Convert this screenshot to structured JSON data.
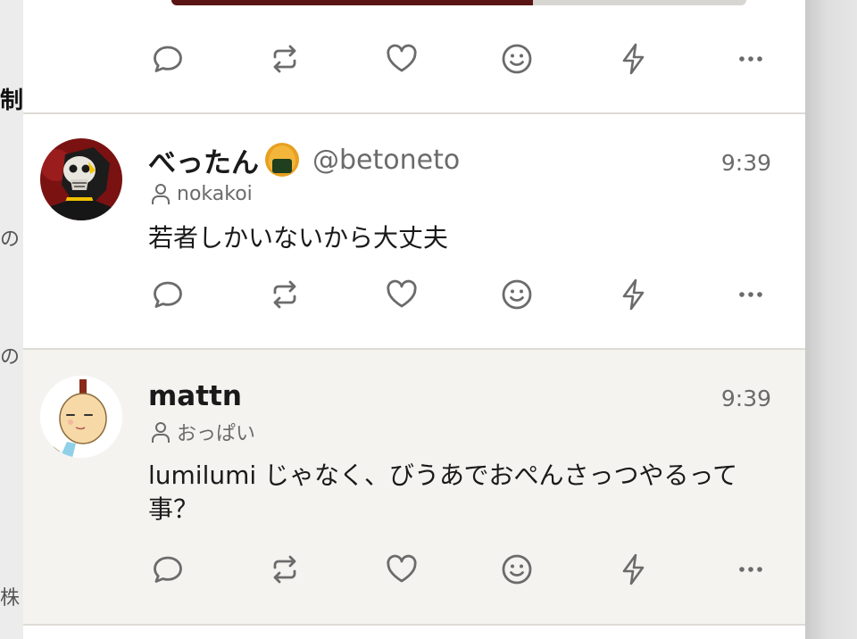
{
  "background_fragments": [
    "制",
    "の",
    "の",
    "株"
  ],
  "colors": {
    "feed_bg": "#ffffff",
    "highlight_bg": "#f4f3f0",
    "icon": "#6b6b6b",
    "text": "#1a1a1a",
    "muted": "#6b6b6b"
  },
  "posts": [
    {
      "display_name": "べったん",
      "name_emoji": "onigiri-emoji",
      "handle": "@betoneto",
      "time": "9:39",
      "sub_text": "nokakoi",
      "body": "若者しかいないから大丈夫"
    },
    {
      "display_name": "mattn",
      "handle": "",
      "time": "9:39",
      "sub_text": "おっぱい",
      "body": "lumilumi じゃなく、びうあでおぺんさっつやるって事？"
    }
  ],
  "actions": [
    "reply-icon",
    "renote-icon",
    "heart-icon",
    "smile-icon",
    "bolt-icon",
    "more-icon"
  ]
}
